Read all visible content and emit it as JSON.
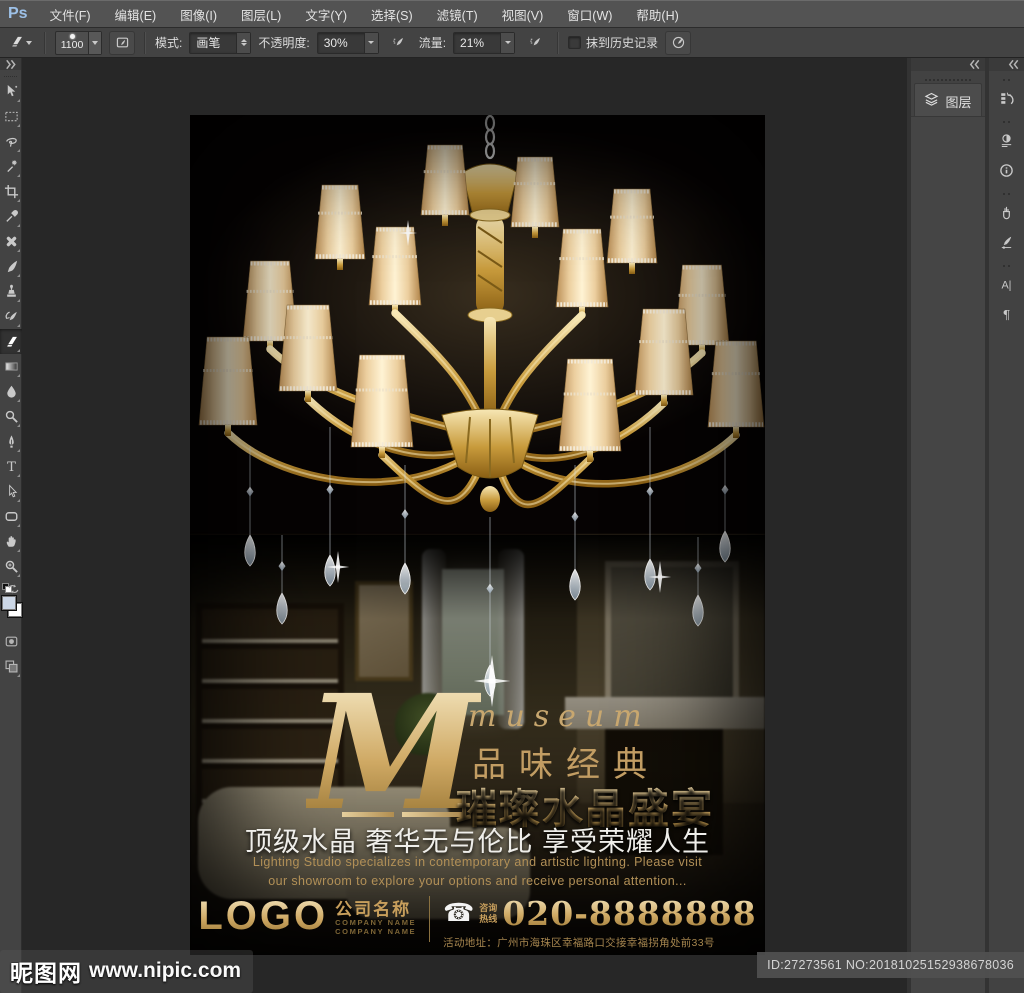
{
  "menu_bar": {
    "logo": "Ps",
    "items": [
      "文件(F)",
      "编辑(E)",
      "图像(I)",
      "图层(L)",
      "文字(Y)",
      "选择(S)",
      "滤镜(T)",
      "视图(V)",
      "窗口(W)",
      "帮助(H)"
    ]
  },
  "options_bar": {
    "tool_icon": "eraser-icon",
    "brush_size": "1100",
    "mode_label": "模式:",
    "mode_value": "画笔",
    "opacity_label": "不透明度:",
    "opacity_value": "30%",
    "flow_label": "流量:",
    "flow_value": "21%",
    "erase_history_label": "抹到历史记录"
  },
  "toolbar": {
    "tools": [
      {
        "name": "move-tool"
      },
      {
        "name": "rectangular-marquee-tool"
      },
      {
        "name": "lasso-tool"
      },
      {
        "name": "magic-wand-tool"
      },
      {
        "name": "crop-tool"
      },
      {
        "name": "eyedropper-tool"
      },
      {
        "name": "healing-brush-tool"
      },
      {
        "name": "brush-tool"
      },
      {
        "name": "clone-stamp-tool"
      },
      {
        "name": "history-brush-tool"
      },
      {
        "name": "eraser-tool",
        "selected": true
      },
      {
        "name": "gradient-tool"
      },
      {
        "name": "blur-tool"
      },
      {
        "name": "dodge-tool"
      },
      {
        "name": "pen-tool"
      },
      {
        "name": "type-tool"
      },
      {
        "name": "path-selection-tool"
      },
      {
        "name": "rounded-rectangle-tool"
      },
      {
        "name": "hand-tool"
      },
      {
        "name": "zoom-tool"
      }
    ]
  },
  "colors": {
    "foreground": "#ccd7e6",
    "background": "#ffffff",
    "accent_gold": "#d4b97e",
    "ui_panel": "#434343",
    "pasteboard": "#272727",
    "poster_black": "#060303",
    "ps_logo_blue": "#9dc1e8"
  },
  "right_panels": {
    "layers_tab_label": "图层",
    "icon_groups": [
      [
        "history-panel"
      ],
      [
        "adjustments-panel",
        "info-panel"
      ],
      [
        "brush-presets-panel",
        "brush-settings-panel"
      ],
      [
        "character-panel",
        "paragraph-panel"
      ]
    ]
  },
  "poster": {
    "m_letter": "M",
    "museum_text": "museum",
    "subtitle": "品味经典",
    "title": "璀璨水晶盛宴",
    "tagline": "顶级水晶 奢华无与伦比 享受荣耀人生",
    "en_line1": "Lighting Studio specializes in contemporary and artistic lighting. Please visit",
    "en_line2": "our showroom to explore your options and receive personal attention...",
    "logo_text": "LOGO",
    "company_cn": "公司名称",
    "company_en1": "COMPANY NAME",
    "company_en2": "COMPANY NAME",
    "phone_icon": "☎",
    "hotline_line1": "咨询",
    "hotline_line2": "热线",
    "phone_number": "020-8888888",
    "address": "活动地址：广州市海珠区幸福路口交接幸福拐角处前33号"
  },
  "watermark": {
    "site_name": "昵图网",
    "site_url": "www.nipic.com",
    "id_text": "ID:27273561 NO:20181025152938678036"
  }
}
